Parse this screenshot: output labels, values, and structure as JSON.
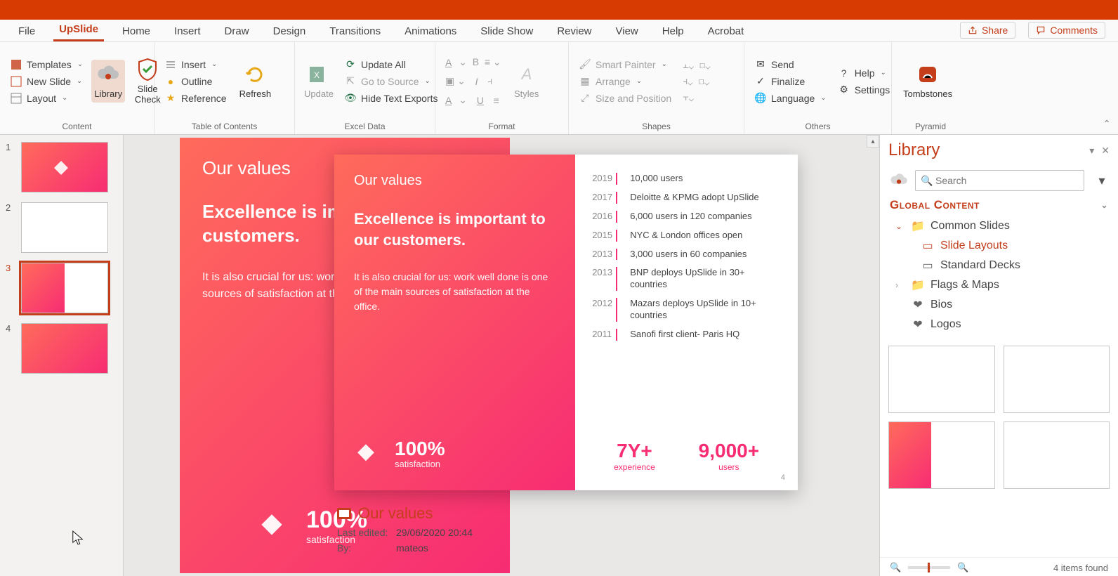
{
  "tabs": {
    "file": "File",
    "upslide": "UpSlide",
    "home": "Home",
    "insert": "Insert",
    "draw": "Draw",
    "design": "Design",
    "transitions": "Transitions",
    "animations": "Animations",
    "slideshow": "Slide Show",
    "review": "Review",
    "view": "View",
    "help": "Help",
    "acrobat": "Acrobat",
    "share": "Share",
    "comments": "Comments"
  },
  "ribbon": {
    "content": {
      "label": "Content",
      "templates": "Templates",
      "newslide": "New Slide",
      "layout": "Layout",
      "library": "Library",
      "slidecheck": "Slide\nCheck"
    },
    "toc": {
      "label": "Table of Contents",
      "insert": "Insert",
      "outline": "Outline",
      "reference": "Reference",
      "refresh": "Refresh"
    },
    "excel": {
      "label": "Excel Data",
      "update": "Update",
      "updateall": "Update All",
      "gotosource": "Go to Source",
      "hide": "Hide Text Exports"
    },
    "format": {
      "label": "Format",
      "styles": "Styles"
    },
    "shapes": {
      "label": "Shapes",
      "smartpainter": "Smart Painter",
      "arrange": "Arrange",
      "sizepos": "Size and Position"
    },
    "others": {
      "label": "Others",
      "send": "Send",
      "finalize": "Finalize",
      "language": "Language",
      "help": "Help",
      "settings": "Settings"
    },
    "pyramid": {
      "label": "Pyramid",
      "tombstones": "Tombstones"
    }
  },
  "thumbs": [
    "1",
    "2",
    "3",
    "4"
  ],
  "slide": {
    "title": "Our values",
    "heading": "Excellence is important to our customers.",
    "body": "It is also crucial for us: work well done is one of the main sources of satisfaction at the office.",
    "stat_value": "100%",
    "stat_label": "satisfaction",
    "timeline": [
      {
        "year": "2019",
        "text": "10,000 users"
      },
      {
        "year": "2017",
        "text": "Deloitte & KPMG adopt UpSlide"
      },
      {
        "year": "2016",
        "text": "6,000 users in 120 companies"
      },
      {
        "year": "2015",
        "text": "NYC & London offices open"
      },
      {
        "year": "2013",
        "text": "3,000 users in 60 companies"
      },
      {
        "year": "2013",
        "text": "BNP deploys UpSlide in 30+ countries"
      },
      {
        "year": "2012",
        "text": "Mazars deploys UpSlide in 10+ countries"
      },
      {
        "year": "2011",
        "text": "Sanofi first client- Paris HQ"
      }
    ],
    "stats": [
      {
        "value": "7Y+",
        "label": "experience"
      },
      {
        "value": "9,000+",
        "label": "users"
      }
    ],
    "pagenum": "4"
  },
  "meta": {
    "title": "Our values",
    "edited_k": "Last edited:",
    "edited_v": "29/06/2020 20:44",
    "by_k": "By:",
    "by_v": "mateos"
  },
  "library": {
    "title": "Library",
    "search_placeholder": "Search",
    "section": "Global Content",
    "tree": {
      "common": "Common Slides",
      "layouts": "Slide Layouts",
      "decks": "Standard Decks",
      "flags": "Flags & Maps",
      "bios": "Bios",
      "logos": "Logos"
    },
    "footer": "4 items found"
  }
}
